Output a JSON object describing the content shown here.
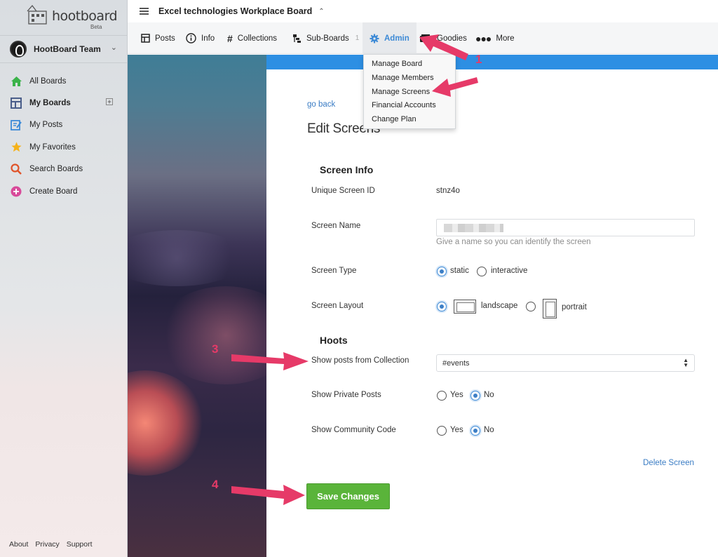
{
  "brand": {
    "name": "hootboard",
    "badge": "Beta"
  },
  "team": {
    "name": "HootBoard Team"
  },
  "sidebar": {
    "items": [
      {
        "label": "All Boards",
        "icon": "home-icon",
        "color": "#3bb34a"
      },
      {
        "label": "My Boards",
        "icon": "boards-icon",
        "color": "#4a5e8a"
      },
      {
        "label": "My Posts",
        "icon": "edit-icon",
        "color": "#3b8ad8"
      },
      {
        "label": "My Favorites",
        "icon": "star-icon",
        "color": "#f5b21a"
      },
      {
        "label": "Search Boards",
        "icon": "search-icon",
        "color": "#e0542a"
      },
      {
        "label": "Create Board",
        "icon": "plus-circle-icon",
        "color": "#d84a9a"
      }
    ],
    "footer": [
      "About",
      "Privacy",
      "Support"
    ]
  },
  "topbar": {
    "board_title": "Excel technologies Workplace Board"
  },
  "tabs": [
    {
      "label": "Posts",
      "icon": "posts-icon"
    },
    {
      "label": "Info",
      "icon": "info-icon"
    },
    {
      "label": "Collections",
      "icon": "hash-icon"
    },
    {
      "label": "Sub-Boards",
      "icon": "subboards-icon",
      "count": "1"
    },
    {
      "label": "Admin",
      "icon": "gear-icon"
    },
    {
      "label": "Goodies",
      "icon": "goodies-icon"
    },
    {
      "label": "More",
      "icon": "more-icon"
    }
  ],
  "admin_menu": [
    "Manage Board",
    "Manage Members",
    "Manage Screens",
    "Financial Accounts",
    "Change Plan"
  ],
  "page": {
    "go_back": "go back",
    "title": "Edit Screens",
    "screen_info_heading": "Screen Info",
    "unique_id_label": "Unique Screen ID",
    "unique_id_value": "stnz4o",
    "screen_name_label": "Screen Name",
    "screen_name_hint": "Give a name so you can identify the screen",
    "screen_type_label": "Screen Type",
    "type_static": "static",
    "type_interactive": "interactive",
    "screen_type_selected": "static",
    "layout_label": "Screen Layout",
    "layout_landscape": "landscape",
    "layout_portrait": "portrait",
    "layout_selected": "landscape",
    "hoots_heading": "Hoots",
    "collection_label": "Show posts from Collection",
    "collection_value": "#events",
    "private_label": "Show Private Posts",
    "private_selected": "No",
    "community_label": "Show Community Code",
    "community_selected": "No",
    "yes": "Yes",
    "no": "No",
    "delete": "Delete Screen",
    "save": "Save Changes"
  },
  "annotations": [
    "1",
    "3",
    "4"
  ],
  "colors": {
    "accent": "#2d8fe3",
    "save": "#5ab43a",
    "annotation": "#e63a68",
    "link": "#3a7cc4"
  }
}
